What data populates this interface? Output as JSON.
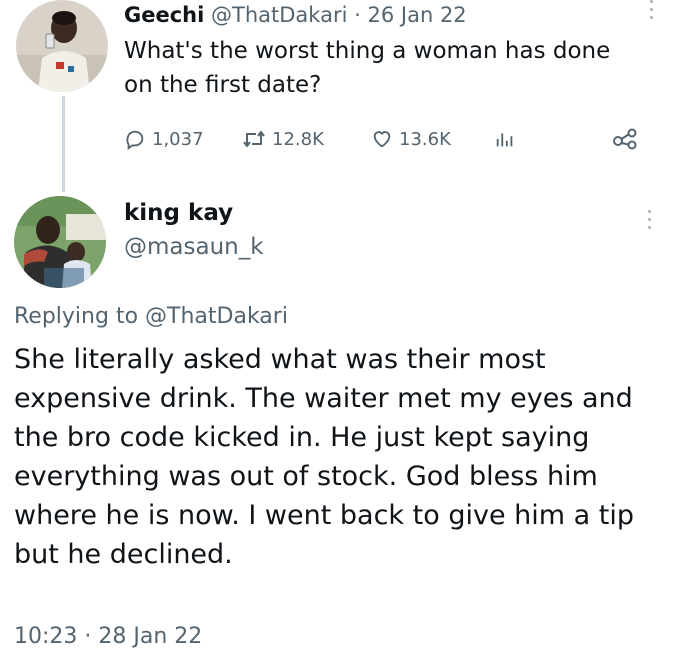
{
  "original_tweet": {
    "display_name": "Geechi",
    "handle": "@ThatDakari",
    "separator": "·",
    "date": "26 Jan 22",
    "text": "What's the worst thing a woman has done on the first date?",
    "stats": {
      "replies": "1,037",
      "retweets": "12.8K",
      "likes": "13.6K"
    },
    "icons": [
      "reply-icon",
      "retweet-icon",
      "like-icon",
      "views-icon",
      "share-icon",
      "more-icon"
    ]
  },
  "reply_tweet": {
    "display_name": "king kay",
    "handle": "@masaun_k",
    "replying_prefix": "Replying to",
    "replying_to": "@ThatDakari",
    "text": "She literally asked what was their most expensive drink. The waiter met my eyes and the bro code kicked in. He just kept saying everything was out of stock. God bless him where he is now. I went back to give him a tip but he declined.",
    "time": "10:23",
    "separator": "·",
    "date": "28 Jan 22"
  },
  "colors": {
    "text": "#0f1419",
    "muted": "#536471",
    "thread_line": "#cfd9de"
  }
}
